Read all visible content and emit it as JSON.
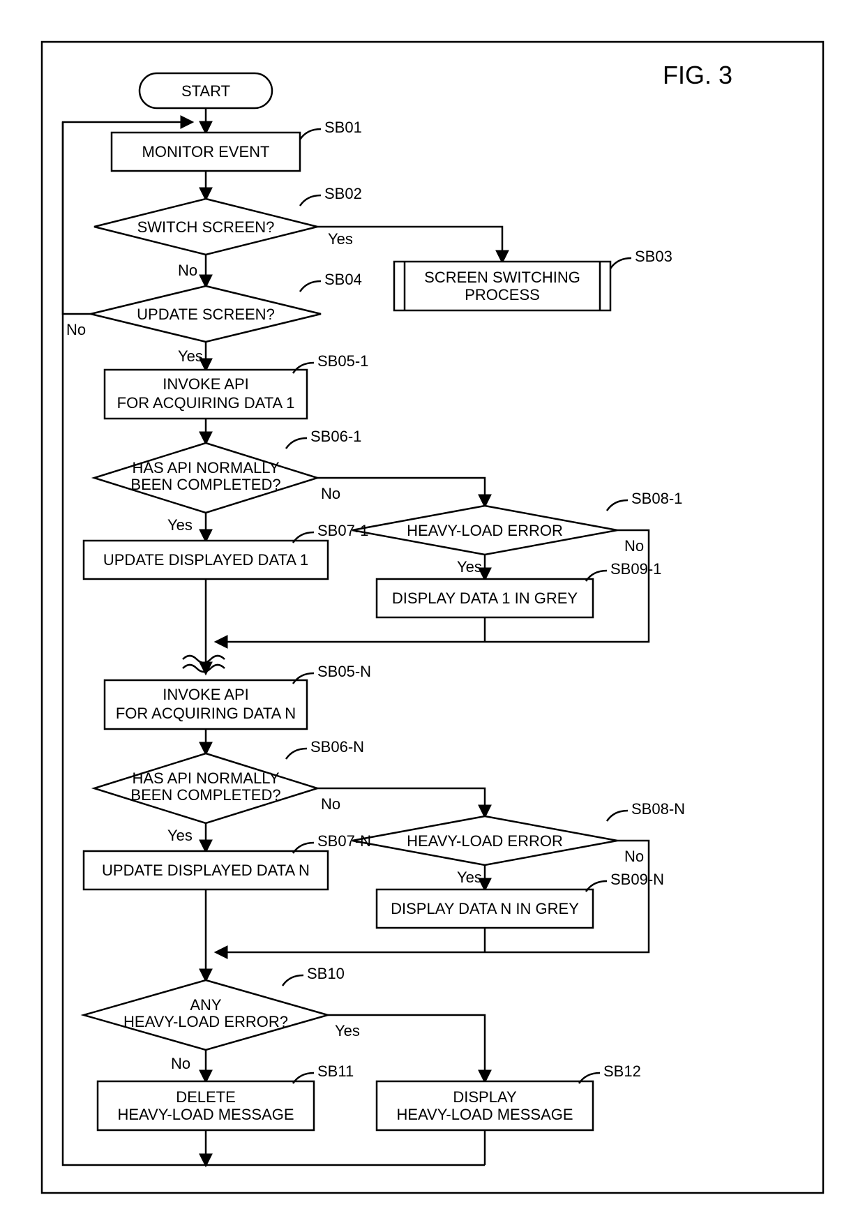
{
  "title": "FIG. 3",
  "nodes": {
    "start": "START",
    "sb01": {
      "lbl": "SB01",
      "t1": "MONITOR EVENT"
    },
    "sb02": {
      "lbl": "SB02",
      "t1": "SWITCH SCREEN?",
      "yes": "Yes",
      "no": "No"
    },
    "sb03": {
      "lbl": "SB03",
      "t1": "SCREEN SWITCHING",
      "t2": "PROCESS"
    },
    "sb04": {
      "lbl": "SB04",
      "t1": "UPDATE SCREEN?",
      "yes": "Yes",
      "no": "No"
    },
    "sb05_1": {
      "lbl": "SB05-1",
      "t1": "INVOKE API",
      "t2": "FOR ACQUIRING DATA 1"
    },
    "sb06_1": {
      "lbl": "SB06-1",
      "t1": "HAS API NORMALLY",
      "t2": "BEEN COMPLETED?",
      "yes": "Yes",
      "no": "No"
    },
    "sb07_1": {
      "lbl": "SB07-1",
      "t1": "UPDATE DISPLAYED DATA 1"
    },
    "sb08_1": {
      "lbl": "SB08-1",
      "t1": "HEAVY-LOAD ERROR",
      "yes": "Yes",
      "no": "No"
    },
    "sb09_1": {
      "lbl": "SB09-1",
      "t1": "DISPLAY DATA 1 IN GREY"
    },
    "sb05_n": {
      "lbl": "SB05-N",
      "t1": "INVOKE API",
      "t2": "FOR ACQUIRING DATA N"
    },
    "sb06_n": {
      "lbl": "SB06-N",
      "t1": "HAS API NORMALLY",
      "t2": "BEEN COMPLETED?",
      "yes": "Yes",
      "no": "No"
    },
    "sb07_n": {
      "lbl": "SB07-N",
      "t1": "UPDATE DISPLAYED DATA N"
    },
    "sb08_n": {
      "lbl": "SB08-N",
      "t1": "HEAVY-LOAD ERROR",
      "yes": "Yes",
      "no": "No"
    },
    "sb09_n": {
      "lbl": "SB09-N",
      "t1": "DISPLAY DATA N IN GREY"
    },
    "sb10": {
      "lbl": "SB10",
      "t1": "ANY",
      "t2": "HEAVY-LOAD ERROR?",
      "yes": "Yes",
      "no": "No"
    },
    "sb11": {
      "lbl": "SB11",
      "t1": "DELETE",
      "t2": "HEAVY-LOAD MESSAGE"
    },
    "sb12": {
      "lbl": "SB12",
      "t1": "DISPLAY",
      "t2": "HEAVY-LOAD MESSAGE"
    }
  }
}
